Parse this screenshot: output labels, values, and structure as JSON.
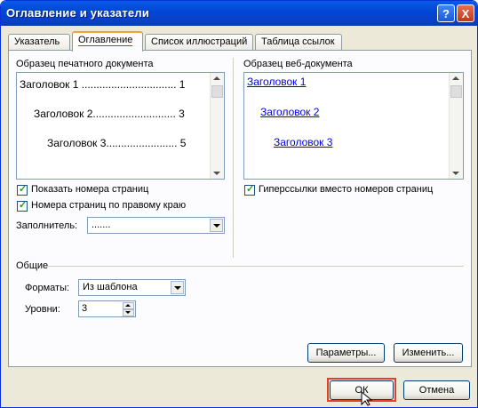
{
  "window": {
    "title": "Оглавление и указатели"
  },
  "title_buttons": {
    "help": "?",
    "close": "X"
  },
  "tabs": [
    {
      "label": "Указатель"
    },
    {
      "label": "Оглавление"
    },
    {
      "label": "Список иллюстраций"
    },
    {
      "label": "Таблица ссылок"
    }
  ],
  "print_preview": {
    "label": "Образец печатного документа",
    "lines": [
      "Заголовок 1 ................................ 1",
      "Заголовок 2............................ 3",
      "Заголовок 3........................ 5"
    ]
  },
  "web_preview": {
    "label": "Образец веб-документа",
    "links": [
      "Заголовок 1",
      "Заголовок 2",
      "Заголовок 3"
    ]
  },
  "checkboxes": {
    "show_page_numbers": "Показать номера страниц",
    "right_align": "Номера страниц по правому краю",
    "hyperlinks": "Гиперссылки вместо номеров страниц"
  },
  "leader": {
    "label": "Заполнитель:",
    "value": "......."
  },
  "general": {
    "title": "Общие",
    "formats_label": "Форматы:",
    "formats_value": "Из шаблона",
    "levels_label": "Уровни:",
    "levels_value": "3"
  },
  "buttons": {
    "options": "Параметры...",
    "modify": "Изменить...",
    "ok": "ОК",
    "cancel": "Отмена"
  }
}
